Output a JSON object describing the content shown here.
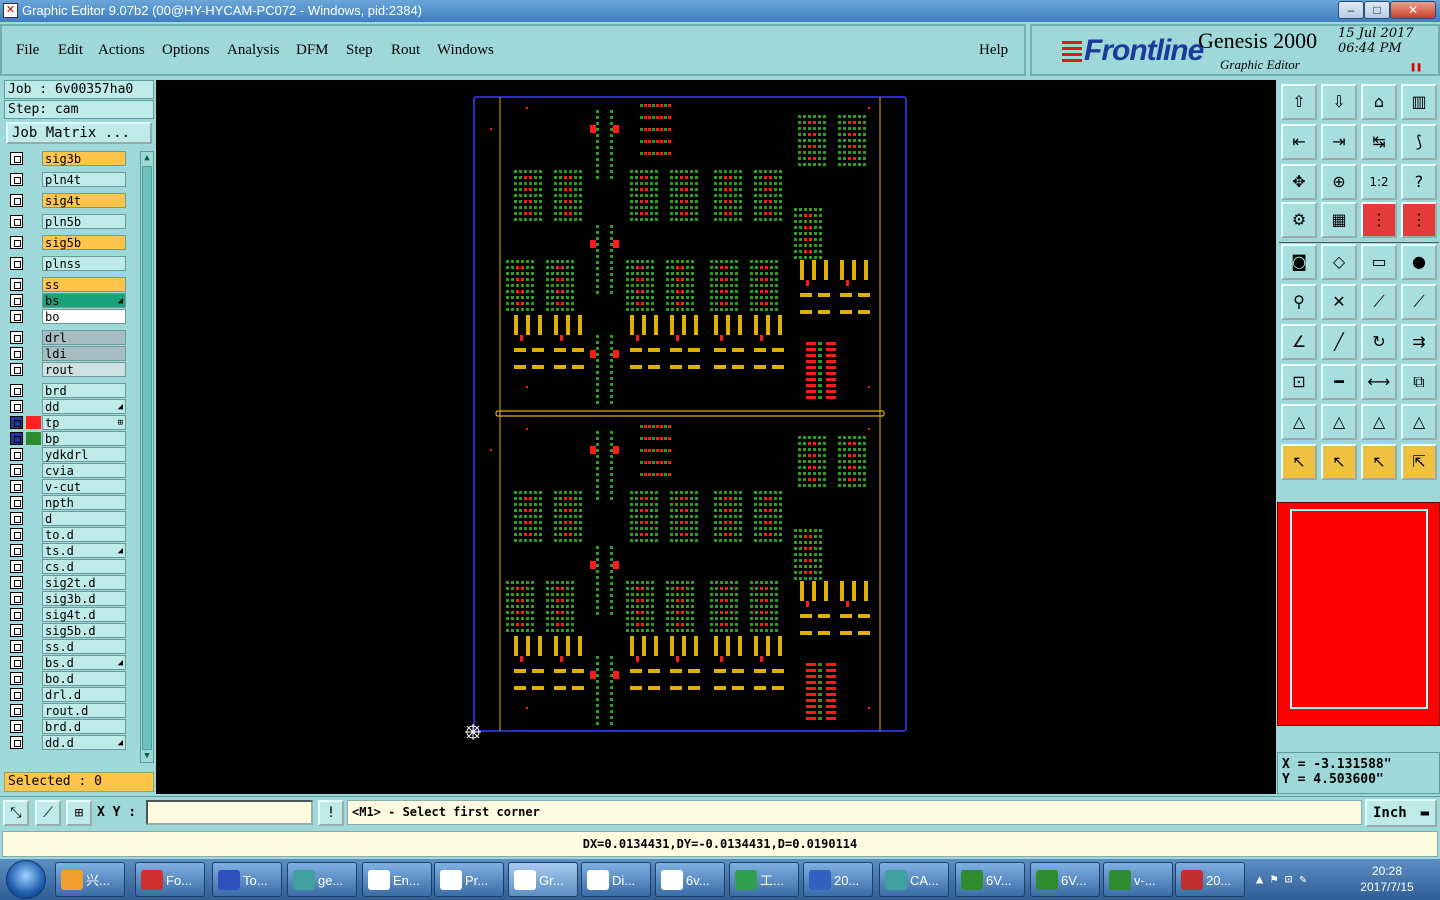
{
  "window": {
    "title": "Graphic Editor 9.07b2 (00@HY-HYCAM-PC072 - Windows, pid:2384)",
    "controls": {
      "minimize": "–",
      "maximize": "□",
      "close": "✕"
    }
  },
  "menubar": {
    "items": [
      "File",
      "Edit",
      "Actions",
      "Options",
      "Analysis",
      "DFM",
      "Step",
      "Rout",
      "Windows"
    ],
    "help": "Help"
  },
  "brand": {
    "logo": "Frontline",
    "product": "Genesis 2000",
    "subtitle": "Graphic Editor",
    "date_line1": "15 Jul 2017",
    "date_line2": "06:44 PM"
  },
  "job": {
    "job_label": "Job : 6v00357ha0",
    "step_label": "Step: cam",
    "matrix_button": "Job Matrix ..."
  },
  "layers": [
    {
      "name": "sig3b",
      "color": "#ffc54a",
      "swatch": ""
    },
    {
      "name": "pln4t",
      "color": "#bfeaea",
      "swatch": ""
    },
    {
      "name": "sig4t",
      "color": "#ffc54a",
      "swatch": ""
    },
    {
      "name": "pln5b",
      "color": "#bfeaea",
      "swatch": ""
    },
    {
      "name": "sig5b",
      "color": "#ffc54a",
      "swatch": ""
    },
    {
      "name": "plnss",
      "color": "#bfeaea",
      "swatch": ""
    },
    {
      "name": "ss",
      "color": "#ffc54a",
      "swatch": ""
    },
    {
      "name": "bs",
      "color": "#1aa37a",
      "swatch": "",
      "mark": "◢"
    },
    {
      "name": "bo",
      "color": "#ffffff",
      "swatch": ""
    },
    {
      "name": "drl",
      "color": "#a8bcc4",
      "swatch": ""
    },
    {
      "name": "ldi",
      "color": "#a8bcc4",
      "swatch": ""
    },
    {
      "name": "rout",
      "color": "#cfe0e0",
      "swatch": ""
    },
    {
      "name": "brd",
      "color": "#bfeaea",
      "swatch": ""
    },
    {
      "name": "dd",
      "color": "#bfeaea",
      "swatch": "",
      "mark": "◢"
    },
    {
      "name": "tp",
      "color": "#bfeaea",
      "swatch": "#ff2020",
      "mark": "⊞"
    },
    {
      "name": "bp",
      "color": "#bfeaea",
      "swatch": "#2e8b2e"
    },
    {
      "name": "ydkdrl",
      "color": "#bfeaea",
      "swatch": ""
    },
    {
      "name": "cvia",
      "color": "#bfeaea",
      "swatch": ""
    },
    {
      "name": "v-cut",
      "color": "#bfeaea",
      "swatch": ""
    },
    {
      "name": "npth",
      "color": "#bfeaea",
      "swatch": ""
    },
    {
      "name": "d",
      "color": "#bfeaea",
      "swatch": ""
    },
    {
      "name": "to.d",
      "color": "#bfeaea",
      "swatch": ""
    },
    {
      "name": "ts.d",
      "color": "#bfeaea",
      "swatch": "",
      "mark": "◢"
    },
    {
      "name": "cs.d",
      "color": "#bfeaea",
      "swatch": ""
    },
    {
      "name": "sig2t.d",
      "color": "#bfeaea",
      "swatch": ""
    },
    {
      "name": "sig3b.d",
      "color": "#bfeaea",
      "swatch": ""
    },
    {
      "name": "sig4t.d",
      "color": "#bfeaea",
      "swatch": ""
    },
    {
      "name": "sig5b.d",
      "color": "#bfeaea",
      "swatch": ""
    },
    {
      "name": "ss.d",
      "color": "#bfeaea",
      "swatch": ""
    },
    {
      "name": "bs.d",
      "color": "#bfeaea",
      "swatch": "",
      "mark": "◢"
    },
    {
      "name": "bo.d",
      "color": "#bfeaea",
      "swatch": ""
    },
    {
      "name": "drl.d",
      "color": "#bfeaea",
      "swatch": ""
    },
    {
      "name": "rout.d",
      "color": "#bfeaea",
      "swatch": ""
    },
    {
      "name": "brd.d",
      "color": "#bfeaea",
      "swatch": ""
    },
    {
      "name": "dd.d",
      "color": "#bfeaea",
      "swatch": "",
      "mark": "◢"
    }
  ],
  "selected": "Selected : 0",
  "coords": {
    "x": "X = -3.131588\"",
    "y": "Y = 4.503600\""
  },
  "bottom": {
    "xy_label": "X Y :",
    "xy_value": "",
    "prompt": "<M1> - Select first corner",
    "unit": "Inch",
    "status": "DX=0.0134431,DY=-0.0134431,D=0.0190114"
  },
  "taskbar": {
    "tasks": [
      {
        "label": "兴...",
        "icon": "#f0a030"
      },
      {
        "label": "Fo...",
        "icon": "#d03030"
      },
      {
        "label": "To...",
        "icon": "#3050c0"
      },
      {
        "label": "ge...",
        "icon": "#40a0a0"
      },
      {
        "label": "En...",
        "icon": "#ffffff"
      },
      {
        "label": "Pr...",
        "icon": "#ffffff"
      },
      {
        "label": "Gr...",
        "icon": "#ffffff"
      },
      {
        "label": "Di...",
        "icon": "#ffffff"
      },
      {
        "label": "6v...",
        "icon": "#ffffff"
      },
      {
        "label": "工...",
        "icon": "#30a050"
      },
      {
        "label": "20...",
        "icon": "#3060c0"
      },
      {
        "label": "CA...",
        "icon": "#40a0a0"
      },
      {
        "label": "6V...",
        "icon": "#2e8b2e"
      },
      {
        "label": "6V...",
        "icon": "#2e8b2e"
      },
      {
        "label": "v-...",
        "icon": "#2e8b2e"
      },
      {
        "label": "20...",
        "icon": "#c03030"
      }
    ],
    "clock_time": "20:28",
    "clock_date": "2017/7/15"
  },
  "canvas_colors": {
    "yellow": "#e0b000",
    "green": "#2c9c20",
    "red": "#ff1a1a",
    "outline": "#3a3aff"
  }
}
